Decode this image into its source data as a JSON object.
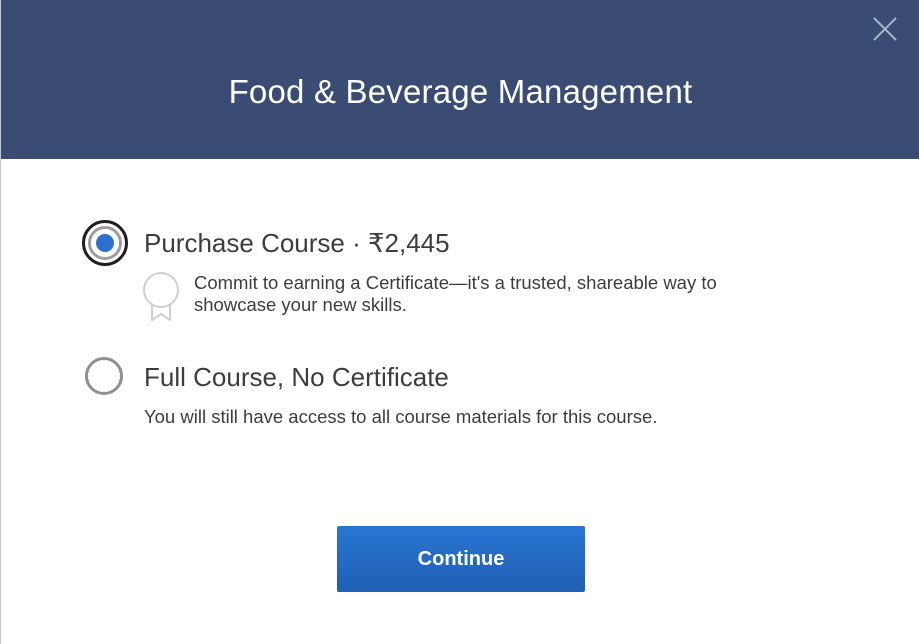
{
  "modal": {
    "title": "Food & Beverage Management",
    "close_icon": "close-icon"
  },
  "options": [
    {
      "label": "Purchase Course · ₹2,445",
      "description": "Commit to earning a Certificate—it's a trusted, shareable way to showcase your new skills.",
      "selected": true,
      "icon": "certificate-ribbon-icon"
    },
    {
      "label": "Full Course, No Certificate",
      "description": "You will still have access to all course materials for this course.",
      "selected": false
    }
  ],
  "actions": {
    "continue_label": "Continue"
  },
  "colors": {
    "header_bg": "#3a4c73",
    "accent": "#2d6fd0",
    "button_bg": "#2466c4",
    "text": "#3d3d3d"
  }
}
